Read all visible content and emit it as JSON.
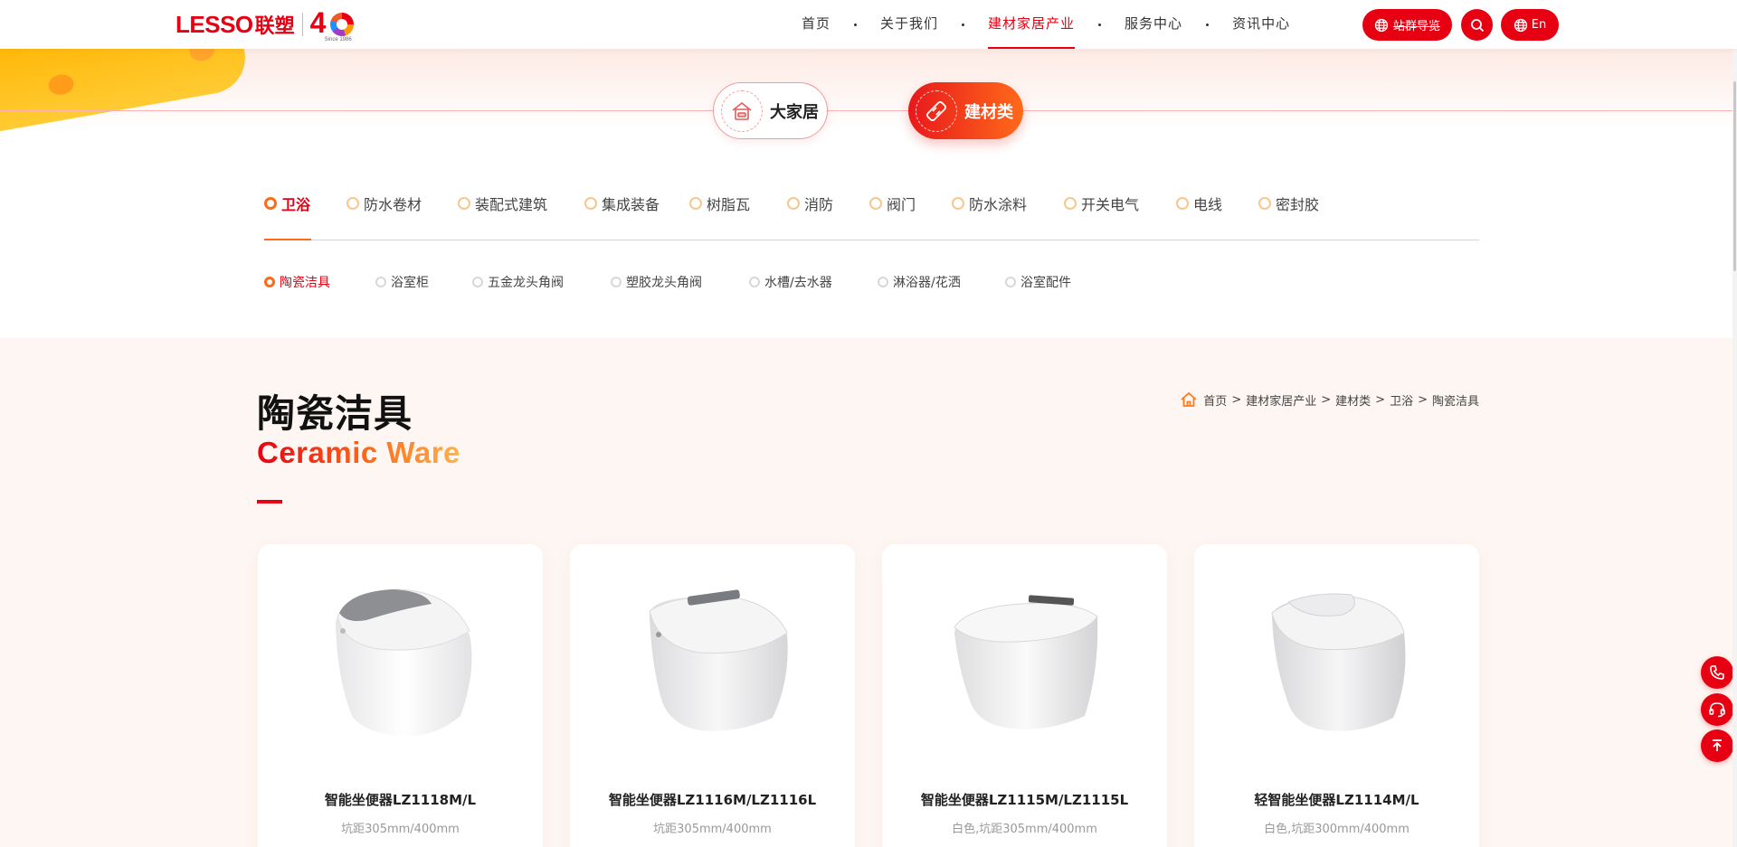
{
  "header": {
    "logo": {
      "brand": "LESSO",
      "brand_cn": "联塑",
      "anniv": "4",
      "since": "Since 1986"
    },
    "nav": [
      {
        "label": "首页",
        "active": false
      },
      {
        "label": "关于我们",
        "active": false
      },
      {
        "label": "建材家居产业",
        "active": true
      },
      {
        "label": "服务中心",
        "active": false
      },
      {
        "label": "资讯中心",
        "active": false
      }
    ],
    "sitemap_label": "站群导览",
    "lang_label": "En"
  },
  "categories": {
    "home_label": "大家居",
    "building_label": "建材类",
    "active": "建材类"
  },
  "tabs_level1": [
    {
      "label": "卫浴",
      "active": true
    },
    {
      "label": "防水卷材",
      "active": false
    },
    {
      "label": "装配式建筑",
      "active": false
    },
    {
      "label": "集成装备",
      "active": false
    },
    {
      "label": "树脂瓦",
      "active": false
    },
    {
      "label": "消防",
      "active": false
    },
    {
      "label": "阀门",
      "active": false
    },
    {
      "label": "防水涂料",
      "active": false
    },
    {
      "label": "开关电气",
      "active": false
    },
    {
      "label": "电线",
      "active": false
    },
    {
      "label": "密封胶",
      "active": false
    }
  ],
  "tabs_level2": [
    {
      "label": "陶瓷洁具",
      "active": true
    },
    {
      "label": "浴室柜",
      "active": false
    },
    {
      "label": "五金龙头角阀",
      "active": false
    },
    {
      "label": "塑胶龙头角阀",
      "active": false
    },
    {
      "label": "水槽/去水器",
      "active": false
    },
    {
      "label": "淋浴器/花洒",
      "active": false
    },
    {
      "label": "浴室配件",
      "active": false
    }
  ],
  "section": {
    "title": "陶瓷洁具",
    "subtitle": "Ceramic Ware"
  },
  "breadcrumb": [
    "首页",
    "建材家居产业",
    "建材类",
    "卫浴",
    "陶瓷洁具"
  ],
  "breadcrumb_sep": ">",
  "products": [
    {
      "name": "智能坐便器LZ1118M/L",
      "desc": "坑距305mm/400mm"
    },
    {
      "name": "智能坐便器LZ1116M/LZ1116L",
      "desc": "坑距305mm/400mm"
    },
    {
      "name": "智能坐便器LZ1115M/LZ1115L",
      "desc": "白色,坑距305mm/400mm"
    },
    {
      "name": "轻智能坐便器LZ1114M/L",
      "desc": "白色,坑距300mm/400mm"
    }
  ],
  "colors": {
    "brand_red": "#e60012",
    "accent_orange": "#ff6a1a",
    "page_bg": "#fdf6f2"
  },
  "icons": {
    "float": [
      "phone-icon",
      "headset-icon",
      "back-to-top-icon"
    ]
  }
}
